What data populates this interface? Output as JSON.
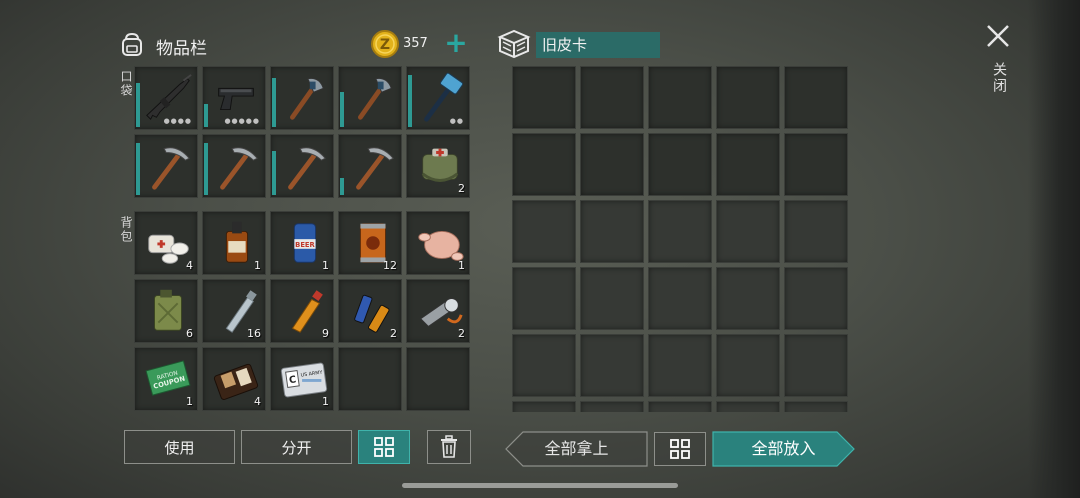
{
  "inventory": {
    "title": "物品栏",
    "coins": "357",
    "pocket_label": "口袋",
    "backpack_label": "背包",
    "pocket_slots": [
      {
        "item": "assault-rifle",
        "qty": "",
        "durability": 0.75,
        "dots": "●●●●"
      },
      {
        "item": "pistol",
        "qty": "",
        "durability": 0.4,
        "dots": "●●●●●"
      },
      {
        "item": "axe",
        "qty": "",
        "durability": 0.85,
        "dots": ""
      },
      {
        "item": "axe",
        "qty": "",
        "durability": 0.6,
        "dots": ""
      },
      {
        "item": "sledgehammer",
        "qty": "",
        "durability": 0.9,
        "dots": "●●"
      },
      {
        "item": "pickaxe",
        "qty": "",
        "durability": 0.9,
        "dots": ""
      },
      {
        "item": "pickaxe",
        "qty": "",
        "durability": 0.9,
        "dots": ""
      },
      {
        "item": "pickaxe",
        "qty": "",
        "durability": 0.75,
        "dots": ""
      },
      {
        "item": "pickaxe",
        "qty": "",
        "durability": 0.3,
        "dots": ""
      },
      {
        "item": "first-aid-bag",
        "qty": "2",
        "durability": 0,
        "dots": ""
      }
    ],
    "backpack_slots": [
      {
        "item": "bandage-pills",
        "qty": "4"
      },
      {
        "item": "whiskey",
        "qty": "1"
      },
      {
        "item": "beer-can",
        "qty": "1"
      },
      {
        "item": "canned-food",
        "qty": "12"
      },
      {
        "item": "raw-chicken",
        "qty": "1"
      },
      {
        "item": "jerry-can",
        "qty": "6"
      },
      {
        "item": "water-bottle",
        "qty": "16"
      },
      {
        "item": "soda-bottle",
        "qty": "9"
      },
      {
        "item": "batteries",
        "qty": "2"
      },
      {
        "item": "flashlight",
        "qty": "2"
      },
      {
        "item": "ration-coupon",
        "qty": "1"
      },
      {
        "item": "wallet",
        "qty": "4"
      },
      {
        "item": "id-card",
        "qty": "1"
      },
      {
        "item": "",
        "qty": ""
      },
      {
        "item": "",
        "qty": ""
      }
    ]
  },
  "item_text": {
    "coupon_line1": "RATION",
    "coupon_line2": "COUPON",
    "beer": "BEER",
    "card_letter": "C",
    "card_text": "US ARMY"
  },
  "container": {
    "title": "旧皮卡"
  },
  "close_label": "关闭",
  "buttons": {
    "use": "使用",
    "split": "分开",
    "take_all": "全部拿上",
    "put_all": "全部放入"
  },
  "colors": {
    "accent": "#2a827d",
    "coin": "#e2b21b"
  }
}
